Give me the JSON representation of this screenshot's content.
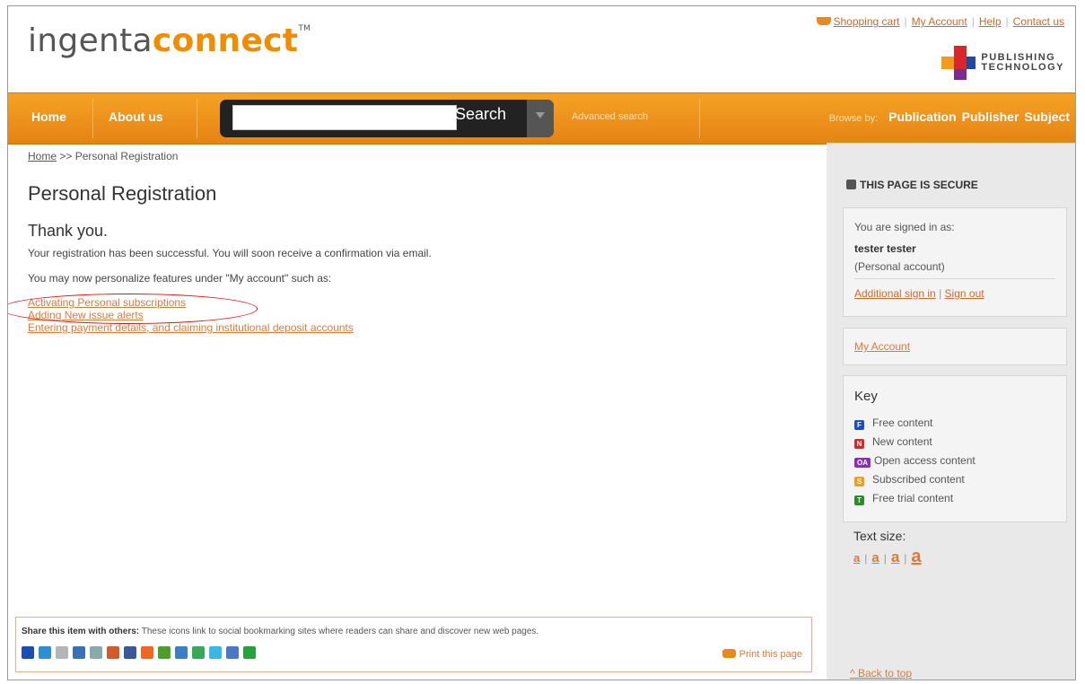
{
  "header": {
    "logo_part1": "ingenta",
    "logo_part2": "connect",
    "logo_tm": "TM",
    "links": [
      "Shopping cart",
      "My Account",
      "Help",
      "Contact us"
    ],
    "publisher_line1": "PUBLISHING",
    "publisher_line2": "TECHNOLOGY"
  },
  "nav": {
    "home": "Home",
    "about": "About us",
    "search_value": "",
    "search_button": "Search",
    "advanced": "Advanced search",
    "browse_label": "Browse by:",
    "browse": [
      "Publication",
      "Publisher",
      "Subject"
    ]
  },
  "breadcrumb": {
    "home": "Home",
    "sep": ">>",
    "current": "Personal Registration"
  },
  "main": {
    "title": "Personal Registration",
    "thank": "Thank you.",
    "p1": "Your registration has been successful. You will soon receive a confirmation via email.",
    "p2": "You may now personalize features under \"My account\" such as:",
    "links": [
      "Activating Personal subscriptions",
      "Adding New issue alerts",
      "Entering payment details, and claiming institutional deposit accounts"
    ]
  },
  "sidebar": {
    "secure": "THIS PAGE IS SECURE",
    "signed_in_as": "You are signed in as:",
    "user": "tester tester",
    "account_type": "(Personal account)",
    "additional_sign_in": "Additional sign in",
    "link_sep": "|",
    "sign_out": "Sign out",
    "my_account": "My Account",
    "key_title": "Key",
    "key_items": [
      {
        "icon": "F",
        "label": "Free content",
        "color": "#1f4fb8"
      },
      {
        "icon": "N",
        "label": "New content",
        "color": "#d8262c"
      },
      {
        "icon": "OA",
        "label": "Open access content",
        "color": "#8c2bb5"
      },
      {
        "icon": "S",
        "label": "Subscribed content",
        "color": "#f29b1c"
      },
      {
        "icon": "T",
        "label": "Free trial content",
        "color": "#2f8a2d"
      }
    ],
    "text_size_label": "Text size:",
    "text_sizes": [
      "a",
      "a",
      "a",
      "a"
    ],
    "text_size_sep": "|",
    "back_to_top": "^ Back to top"
  },
  "share": {
    "bold": "Share this item with others:",
    "text": " These icons link to social bookmarking sites where readers can share and discover new web pages.",
    "print": "Print this page",
    "icon_names": [
      "delicious-icon",
      "hugg-icon",
      "ma-gnolia-icon",
      "digg-like-icon",
      "netvibes-icon",
      "reddit-icon",
      "facebook-icon",
      "stumbleupon-icon",
      "furl-icon",
      "slashdot-icon",
      "technorati-icon",
      "twitter-icon",
      "google-icon",
      "addthis-icon"
    ],
    "icon_colors": [
      "#1b4db3",
      "#2d8fd2",
      "#b5b5b5",
      "#3b6fb6",
      "#8aa",
      "#d05a2a",
      "#3b5998",
      "#f26522",
      "#4d9e2d",
      "#3a7fc1",
      "#3aa85a",
      "#3bb6e8",
      "#4a78c7",
      "#23a33d"
    ]
  },
  "colors": {
    "brand_orange": "#f08c00",
    "link": "#d97a3b"
  }
}
